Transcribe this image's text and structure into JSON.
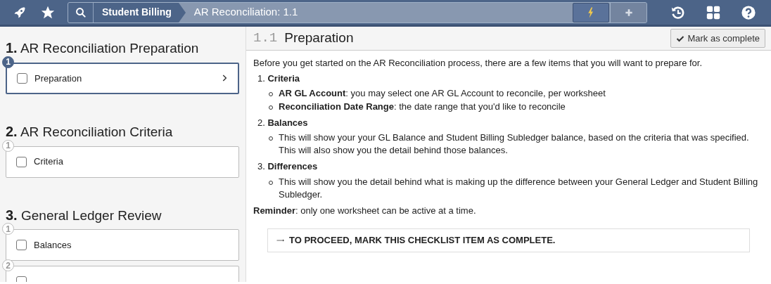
{
  "topbar": {
    "breadcrumb": [
      {
        "label": "Student Billing",
        "kind": "parent"
      },
      {
        "label": "AR Reconciliation: 1.1",
        "kind": "current"
      }
    ]
  },
  "sidebar": {
    "sections": [
      {
        "number": "1.",
        "title": "AR Reconciliation Preparation",
        "items": [
          {
            "number": "1",
            "label": "Preparation",
            "checked": false,
            "selected": true
          }
        ]
      },
      {
        "number": "2.",
        "title": "AR Reconciliation Criteria",
        "items": [
          {
            "number": "1",
            "label": "Criteria",
            "checked": false,
            "selected": false
          }
        ]
      },
      {
        "number": "3.",
        "title": "General Ledger Review",
        "items": [
          {
            "number": "1",
            "label": "Balances",
            "checked": false,
            "selected": false
          },
          {
            "number": "2",
            "checked": false,
            "selected": false
          }
        ]
      }
    ]
  },
  "content": {
    "step_number": "1.1",
    "title": "Preparation",
    "complete_button": "Mark as complete",
    "intro": "Before you get started on the AR Reconciliation process, there are a few items that you will want to prepare for.",
    "steps": [
      {
        "number": "1.",
        "title": "Criteria",
        "bullets": [
          "**AR GL Account**: you may select one AR GL Account to reconcile, per worksheet",
          "**Reconciliation Date Range**: the date range that you'd like to reconcile"
        ]
      },
      {
        "number": "2.",
        "title": "Balances",
        "bullets": [
          "This will show your your GL Balance and Student Billing Subledger balance, based on the criteria that was specified. This will also show you the detail behind those balances."
        ]
      },
      {
        "number": "3.",
        "title": "Differences",
        "bullets": [
          "This will show you the detail behind what is making up the difference between your General Ledger and Student Billing Subledger."
        ]
      }
    ],
    "reminder": "**Reminder**: only one worksheet can be active at a time.",
    "callout": "TO PROCEED, MARK THIS CHECKLIST ITEM AS COMPLETE."
  }
}
